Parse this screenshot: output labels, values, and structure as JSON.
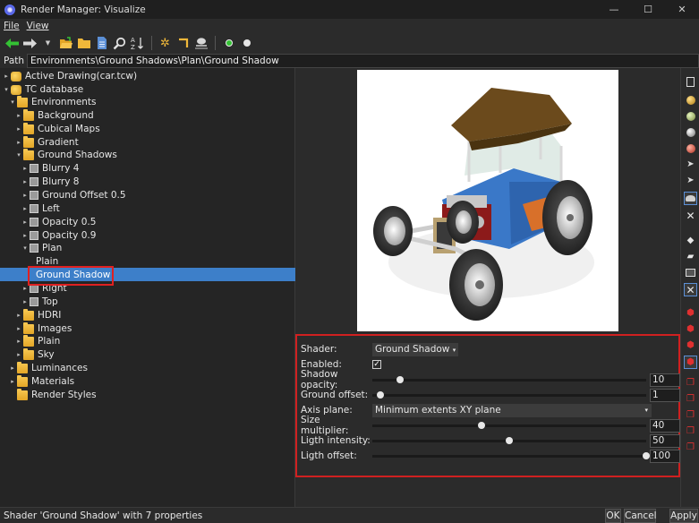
{
  "window": {
    "title": "Render Manager: Visualize",
    "minimize": "—",
    "maximize": "☐",
    "close": "✕"
  },
  "menu": {
    "file": "File",
    "view": "View"
  },
  "path": {
    "label": "Path",
    "value": "Environments\\Ground Shadows\\Plan\\Ground Shadow"
  },
  "tree": {
    "active_drawing": "Active Drawing(car.tcw)",
    "tc_database": "TC database",
    "environments": "Environments",
    "background": "Background",
    "cubical_maps": "Cubical Maps",
    "gradient": "Gradient",
    "ground_shadows": "Ground Shadows",
    "blurry4": "Blurry 4",
    "blurry8": "Blurry 8",
    "ground_offset": "Ground Offset 0.5",
    "left": "Left",
    "opacity05": "Opacity 0.5",
    "opacity09": "Opacity 0.9",
    "plan": "Plan",
    "plain_child": "Plain",
    "ground_shadow": "Ground Shadow",
    "right": "Right",
    "top": "Top",
    "hdri": "HDRI",
    "images": "Images",
    "plain": "Plain",
    "sky": "Sky",
    "luminances": "Luminances",
    "materials": "Materials",
    "render_styles": "Render Styles"
  },
  "properties": {
    "shader_label": "Shader:",
    "shader_value": "Ground Shadow",
    "enabled_label": "Enabled:",
    "enabled_mark": "✓",
    "shadow_opacity_label": "Shadow opacity:",
    "shadow_opacity": "10",
    "shadow_opacity_level": 0.1,
    "ground_offset_label": "Ground offset:",
    "ground_offset": "1",
    "ground_offset_level": 0.03,
    "axis_plane_label": "Axis plane:",
    "axis_plane_value": "Minimum extents XY plane",
    "size_multiplier_label": "Size multiplier:",
    "size_multiplier": "40",
    "size_multiplier_level": 0.4,
    "light_intensity_label": "Ligth intensity:",
    "light_intensity": "50",
    "light_intensity_level": 0.5,
    "light_offset_label": "Ligth offset:",
    "light_offset": "100",
    "light_offset_level": 1.0
  },
  "status": {
    "text": "Shader 'Ground Shadow' with 7 properties",
    "ok": "OK",
    "cancel": "Cancel",
    "apply": "Apply"
  },
  "colors": {
    "selection": "#3d7fc9",
    "highlight_border": "#d02020",
    "folder": "#f0b83a",
    "arrow_green": "#34c234"
  }
}
